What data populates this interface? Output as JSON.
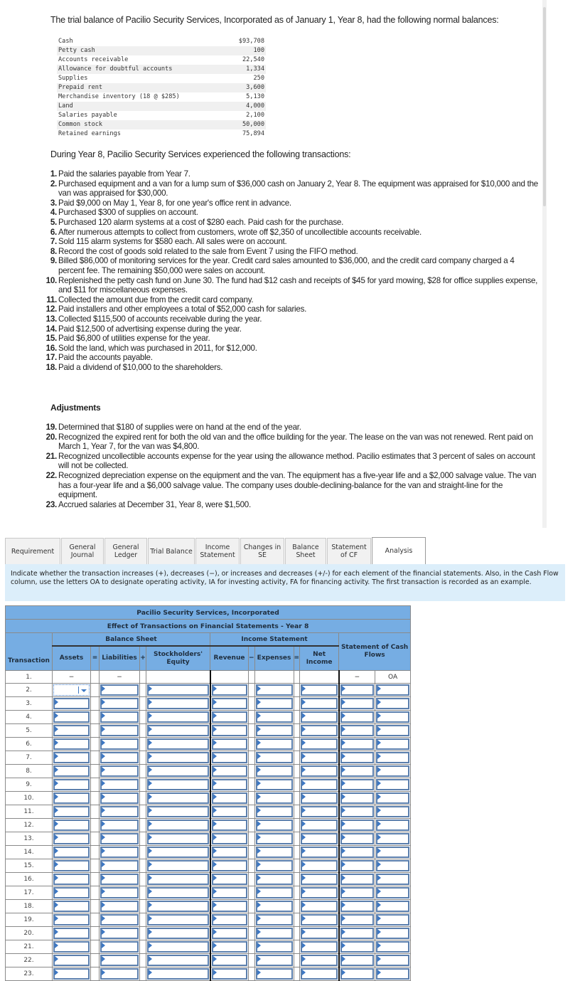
{
  "intro": "The trial balance of Pacilio Security Services, Incorporated as of January 1, Year 8, had the following normal balances:",
  "trial_balance": [
    {
      "account": "Cash",
      "amount": "$93,708"
    },
    {
      "account": "Petty cash",
      "amount": "100"
    },
    {
      "account": "Accounts receivable",
      "amount": "22,540"
    },
    {
      "account": "Allowance for doubtful accounts",
      "amount": "1,334"
    },
    {
      "account": "Supplies",
      "amount": "250"
    },
    {
      "account": "Prepaid rent",
      "amount": "3,600"
    },
    {
      "account": "Merchandise inventory (18 @ $285)",
      "amount": "5,130"
    },
    {
      "account": "Land",
      "amount": "4,000"
    },
    {
      "account": "Salaries payable",
      "amount": "2,100"
    },
    {
      "account": "Common stock",
      "amount": "50,000"
    },
    {
      "account": "Retained earnings",
      "amount": "75,894"
    }
  ],
  "during_text": "During Year 8, Pacilio Security Services experienced the following transactions:",
  "transactions": [
    {
      "n": "1.",
      "text": "Paid the salaries payable from Year 7."
    },
    {
      "n": "2.",
      "text": "Purchased equipment and a van for a lump sum of $36,000 cash on January 2, Year 8. The equipment was appraised for $10,000 and the van was appraised for $30,000."
    },
    {
      "n": "3.",
      "text": "Paid $9,000 on May 1, Year 8, for one year's office rent in advance."
    },
    {
      "n": "4.",
      "text": "Purchased $300 of supplies on account."
    },
    {
      "n": "5.",
      "text": "Purchased 120 alarm systems at a cost of $280 each. Paid cash for the purchase."
    },
    {
      "n": "6.",
      "text": "After numerous attempts to collect from customers, wrote off $2,350 of uncollectible accounts receivable."
    },
    {
      "n": "7.",
      "text": "Sold 115 alarm systems for $580 each. All sales were on account."
    },
    {
      "n": "8.",
      "text": "Record the cost of goods sold related to the sale from Event 7 using the FIFO method."
    },
    {
      "n": "9.",
      "text": "Billed $86,000 of monitoring services for the year. Credit card sales amounted to $36,000, and the credit card company charged a 4 percent fee. The remaining $50,000 were sales on account."
    },
    {
      "n": "10.",
      "text": "Replenished the petty cash fund on June 30. The fund had $12 cash and receipts of $45 for yard mowing, $28 for office supplies expense, and $11 for miscellaneous expenses."
    },
    {
      "n": "11.",
      "text": "Collected the amount due from the credit card company."
    },
    {
      "n": "12.",
      "text": "Paid installers and other employees a total of $52,000 cash for salaries."
    },
    {
      "n": "13.",
      "text": "Collected $115,500 of accounts receivable during the year."
    },
    {
      "n": "14.",
      "text": "Paid $12,500 of advertising expense during the year."
    },
    {
      "n": "15.",
      "text": "Paid $6,800 of utilities expense for the year."
    },
    {
      "n": "16.",
      "text": "Sold the land, which was purchased in 2011, for $12,000."
    },
    {
      "n": "17.",
      "text": "Paid the accounts payable."
    },
    {
      "n": "18.",
      "text": "Paid a dividend of $10,000 to the shareholders."
    }
  ],
  "adjustments_title": "Adjustments",
  "adjustments": [
    {
      "n": "19.",
      "text": "Determined that $180 of supplies were on hand at the end of the year."
    },
    {
      "n": "20.",
      "text": "Recognized the expired rent for both the old van and the office building for the year. The lease on the van was not renewed. Rent paid on March 1, Year 7, for the van was $4,800."
    },
    {
      "n": "21.",
      "text": "Recognized uncollectible accounts expense for the year using the allowance method. Pacilio estimates that 3 percent of sales on account will not be collected."
    },
    {
      "n": "22.",
      "text": "Recognized depreciation expense on the equipment and the van. The equipment has a five-year life and a $2,000 salvage value. The van has a four-year life and a $6,000 salvage value. The company uses double-declining-balance for the van and straight-line for the equipment."
    },
    {
      "n": "23.",
      "text": "Accrued salaries at December 31, Year 8, were $1,500."
    }
  ],
  "tabs": [
    {
      "id": "requirement",
      "label": "Requirement",
      "active": false
    },
    {
      "id": "general-journal",
      "label": "General Journal",
      "active": false
    },
    {
      "id": "general-ledger",
      "label": "General Ledger",
      "active": false
    },
    {
      "id": "trial-balance",
      "label": "Trial Balance",
      "active": false
    },
    {
      "id": "income-statement",
      "label": "Income Statement",
      "active": false
    },
    {
      "id": "changes-in-se",
      "label": "Changes in SE",
      "active": false
    },
    {
      "id": "balance-sheet",
      "label": "Balance Sheet",
      "active": false
    },
    {
      "id": "statement-of-cf",
      "label": "Statement of CF",
      "active": false
    },
    {
      "id": "analysis",
      "label": "Analysis",
      "active": true
    }
  ],
  "instructions": "Indicate whether the transaction increases (+), decreases (−), or increases and decreases (+/-) for each element of the financial statements. Also, in the Cash Flow column, use the letters OA to designate operating activity, IA for investing activity, FA for financing activity. The first transaction is recorded as an example.",
  "analysis_table": {
    "company": "Pacilio Security Services, Incorporated",
    "subtitle": "Effect of Transactions on Financial Statements - Year 8",
    "groups": {
      "balance_sheet": "Balance Sheet",
      "income_statement": "Income Statement",
      "cash_flows": "Statement of Cash Flows"
    },
    "headers": {
      "transaction": "Transaction",
      "assets": "Assets",
      "eq1": "=",
      "liabilities": "Liabilities",
      "plus": "+",
      "equity": "Stockholders' Equity",
      "revenue": "Revenue",
      "minus": "−",
      "expenses": "Expenses",
      "eq2": "=",
      "net_income": "Net Income"
    },
    "example_row": {
      "n": "1.",
      "assets": "−",
      "liabilities": "−",
      "equity": "",
      "revenue": "",
      "expenses": "",
      "net_income": "",
      "cf_sign": "−",
      "cf_activity": "OA"
    },
    "input_rows": [
      "2.",
      "3.",
      "4.",
      "5.",
      "6.",
      "7.",
      "8.",
      "9.",
      "10.",
      "11.",
      "12.",
      "13.",
      "14.",
      "15.",
      "16.",
      "17.",
      "18.",
      "19.",
      "20.",
      "21.",
      "22.",
      "23."
    ]
  }
}
